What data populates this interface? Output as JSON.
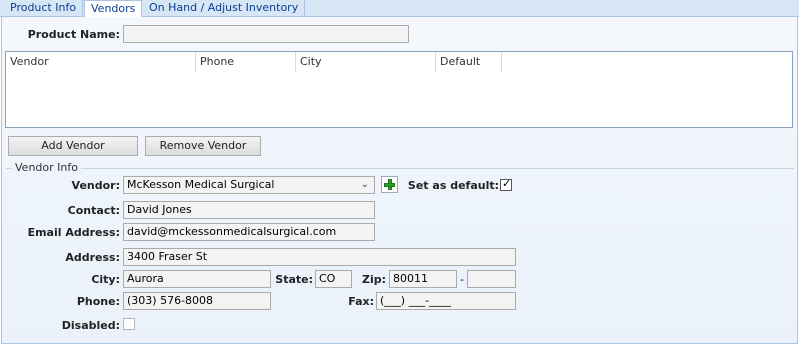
{
  "tabs": [
    "Product Info",
    "Vendors",
    "On Hand / Adjust Inventory"
  ],
  "product_name_label": "Product Name:",
  "product_name_value": "",
  "grid": {
    "columns": [
      "Vendor",
      "Phone",
      "City",
      "Default"
    ],
    "rows": []
  },
  "buttons": {
    "add_vendor": "Add Vendor",
    "remove_vendor": "Remove Vendor"
  },
  "vendor_info": {
    "legend": "Vendor Info",
    "vendor_label": "Vendor:",
    "vendor_value": "McKesson Medical Surgical",
    "set_default_label": "Set as default:",
    "set_default_checked": true,
    "contact_label": "Contact:",
    "contact_value": "David Jones",
    "email_label": "Email Address:",
    "email_value": "david@mckessonmedicalsurgical.com",
    "address_label": "Address:",
    "address_value": "3400 Fraser St",
    "city_label": "City:",
    "city_value": "Aurora",
    "state_label": "State:",
    "state_value": "CO",
    "zip_label": "Zip:",
    "zip_value": "80011",
    "zip_dash": "-",
    "zip_ext_value": "",
    "phone_label": "Phone:",
    "phone_value": "(303) 576-8008",
    "fax_label": "Fax:",
    "fax_value": "(___) ___-____",
    "disabled_label": "Disabled:",
    "disabled_checked": false
  },
  "icons": {
    "add_icon": "plus-icon",
    "dropdown_icon": "chevron-down-icon",
    "check_icon": "check-icon"
  },
  "colors": {
    "tab_bar": "#d6e6f5",
    "tab_text": "#0b3d91",
    "panel_bg": "#eef4fb",
    "plus_green": "#2ca02c"
  }
}
